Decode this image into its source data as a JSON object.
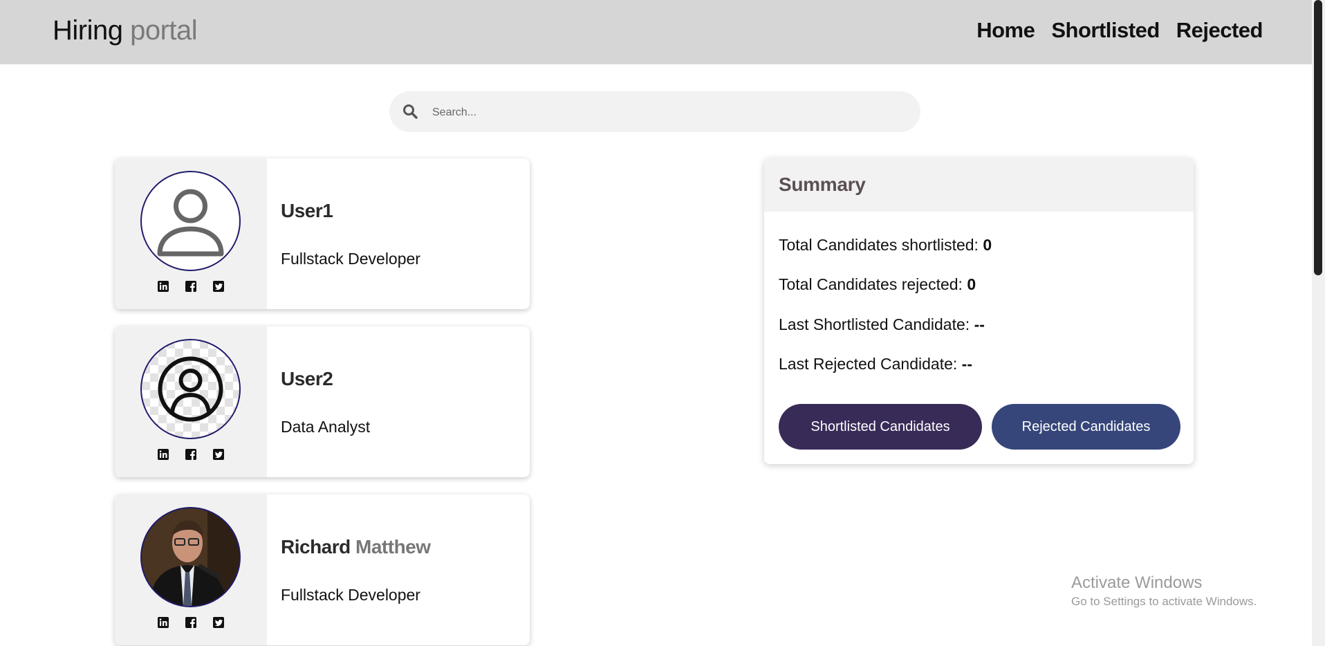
{
  "header": {
    "brand_first": "Hiring",
    "brand_second": "portal",
    "nav": [
      "Home",
      "Shortlisted",
      "Rejected"
    ]
  },
  "search": {
    "placeholder": "Search..."
  },
  "candidates": [
    {
      "first_name": "User1",
      "last_name": "",
      "role": "Fullstack Developer"
    },
    {
      "first_name": "User2",
      "last_name": "",
      "role": "Data Analyst"
    },
    {
      "first_name": "Richard",
      "last_name": "Matthew",
      "role": "Fullstack Developer"
    }
  ],
  "summary": {
    "title": "Summary",
    "shortlisted_label": "Total Candidates shortlisted:",
    "shortlisted_count": "0",
    "rejected_label": "Total Candidates rejected:",
    "rejected_count": "0",
    "last_shortlisted_label": "Last Shortlisted Candidate:",
    "last_shortlisted_value": "--",
    "last_rejected_label": "Last Rejected Candidate:",
    "last_rejected_value": "--",
    "shortlisted_button": "Shortlisted Candidates",
    "rejected_button": "Rejected Candidates"
  },
  "watermark": {
    "title": "Activate Windows",
    "subtitle": "Go to Settings to activate Windows."
  },
  "colors": {
    "navbar_bg": "#d6d6d6",
    "avatar_border": "#1e1a6b",
    "shortlisted_button": "#392b58",
    "rejected_button": "#36467a"
  }
}
